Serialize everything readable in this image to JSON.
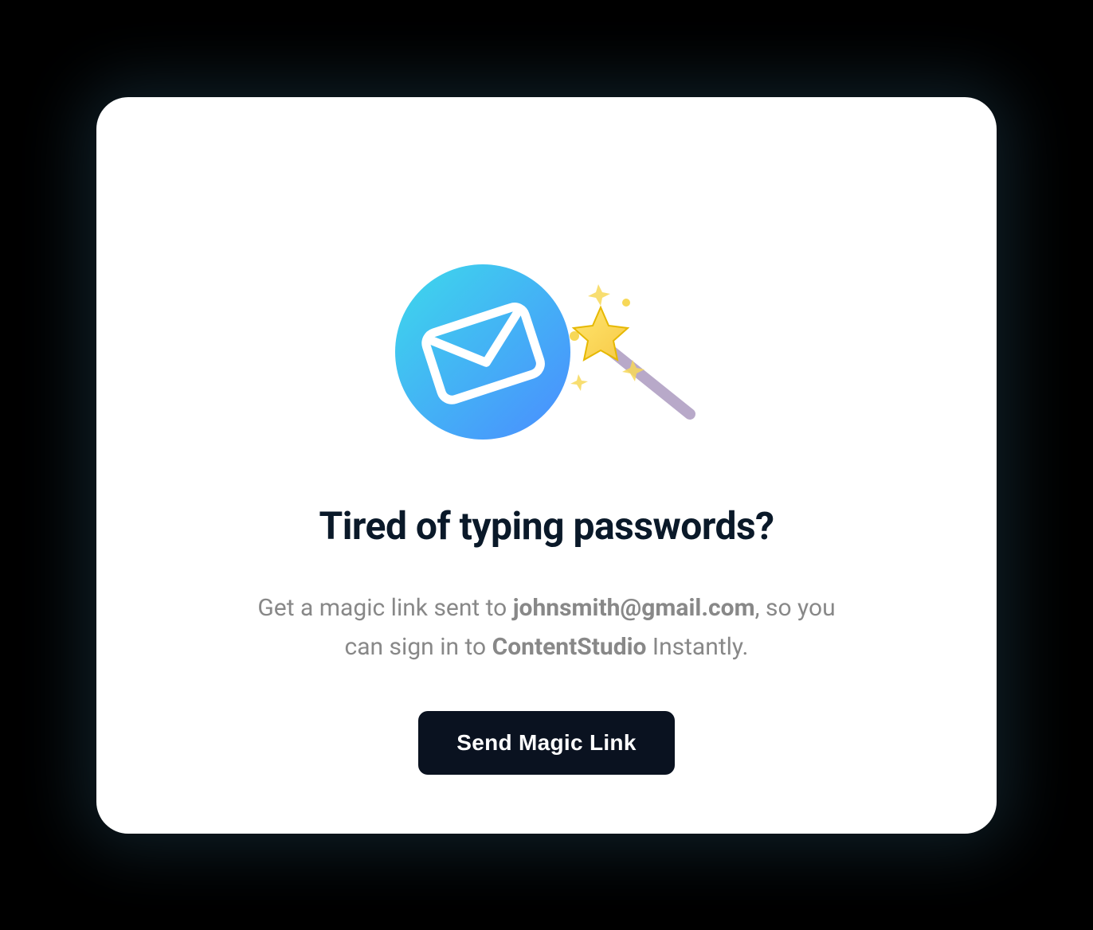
{
  "card": {
    "heading": "Tired of typing passwords?",
    "description_prefix": "Get a magic link sent to ",
    "email": "johnsmith@gmail.com",
    "description_middle": ", so you can sign in to ",
    "app_name": "ContentStudio",
    "description_suffix": " Instantly.",
    "button_label": "Send Magic Link"
  }
}
